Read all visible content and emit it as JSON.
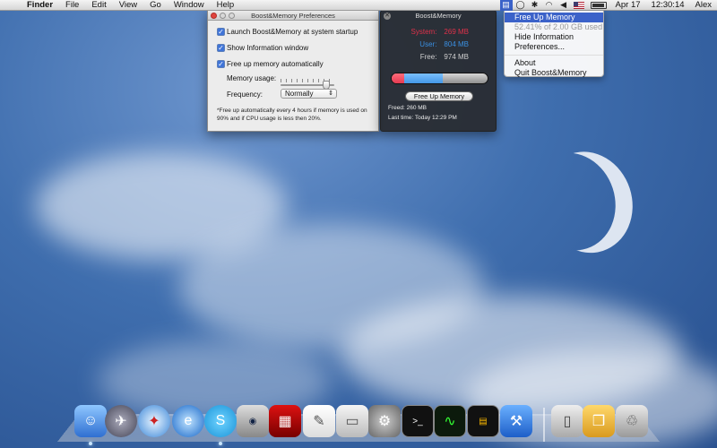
{
  "menubar": {
    "apple": "",
    "menus": [
      "Finder",
      "File",
      "Edit",
      "View",
      "Go",
      "Window",
      "Help"
    ],
    "date": "Apr 17",
    "time": "12:30:14",
    "user": "Alex"
  },
  "tray_menu": {
    "items": [
      {
        "label": "Free Up Memory",
        "state": "highlighted"
      },
      {
        "label": "52.41% of 2.00 GB used",
        "state": "disabled"
      },
      {
        "label": "Hide Information",
        "state": "normal"
      },
      {
        "label": "Preferences...",
        "state": "normal"
      },
      {
        "label": "About",
        "state": "normal"
      },
      {
        "label": "Quit Boost&Memory",
        "state": "normal"
      }
    ]
  },
  "preferences": {
    "title": "Boost&Memory Preferences",
    "launch_label": "Launch Boost&Memory at system startup",
    "show_info_label": "Show Information window",
    "auto_free_label": "Free up memory automatically",
    "memory_usage_label": "Memory usage:",
    "memory_usage_level": 0.85,
    "frequency_label": "Frequency:",
    "frequency_value": "Normally",
    "note": "*Free up automatically every 4 hours if memory is used on 90% and if CPU usage is less then 20%."
  },
  "panel": {
    "title": "Boost&Memory",
    "close_glyph": "✕",
    "system_label": "System:",
    "system_value": "269 MB",
    "user_label": "User:",
    "user_value": "804 MB",
    "free_label": "Free:",
    "free_value": "974 MB",
    "button_label": "Free Up Memory",
    "freed": "Freed: 260 MB",
    "last_time": "Last time: Today 12:29 PM",
    "colors": {
      "system": "#e0314a",
      "user": "#3a8fe0",
      "free": "#cfcfcf"
    }
  },
  "dock": {
    "icons": [
      "finder-icon",
      "launchpad-icon",
      "safari-icon",
      "ie-icon",
      "skype-icon",
      "camera-icon",
      "photo-booth-icon",
      "textedit-icon",
      "preview-icon",
      "system-preferences-icon",
      "terminal-icon",
      "activity-monitor-icon",
      "console-icon",
      "xcode-icon",
      "archive-icon",
      "box-icon",
      "trash-icon"
    ]
  }
}
